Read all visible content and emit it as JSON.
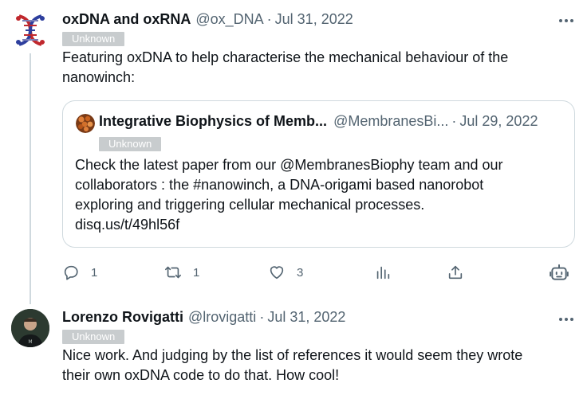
{
  "tweet1": {
    "display_name": "oxDNA and oxRNA",
    "handle": "@ox_DNA",
    "separator": "·",
    "date": "Jul 31, 2022",
    "badge": "Unknown",
    "text_line1": "Featuring oxDNA to help characterise the mechanical behaviour of the",
    "text_line2": "nanowinch:",
    "quote": {
      "display_name": "Integrative Biophysics of Memb...",
      "handle": "@MembranesBi...",
      "separator": "·",
      "date": "Jul 29, 2022",
      "badge": "Unknown",
      "text": "Check the latest paper from our @MembranesBiophy team and our\ncollaborators  : the #nanowinch, a DNA-origami based nanorobot\nexploring and triggering cellular mechanical processes.\n disq.us/t/49hl56f"
    },
    "actions": {
      "replies": "1",
      "retweets": "1",
      "likes": "3"
    }
  },
  "tweet2": {
    "display_name": "Lorenzo Rovigatti",
    "handle": "@lrovigatti",
    "separator": "·",
    "date": "Jul 31, 2022",
    "badge": "Unknown",
    "text_line1": "Nice work. And judging by the list of references it would seem they wrote",
    "text_line2": "their own oxDNA code to do that. How cool!"
  },
  "icons": {
    "more": "more-horizontal-icon",
    "reply": "reply-icon",
    "retweet": "retweet-icon",
    "like": "heart-icon",
    "views": "analytics-icon",
    "share": "share-icon",
    "grok": "grok-icon"
  },
  "colors": {
    "text": "#0f1419",
    "secondary": "#536471",
    "border": "#cfd9de",
    "badge_bg": "#c8ccce"
  }
}
